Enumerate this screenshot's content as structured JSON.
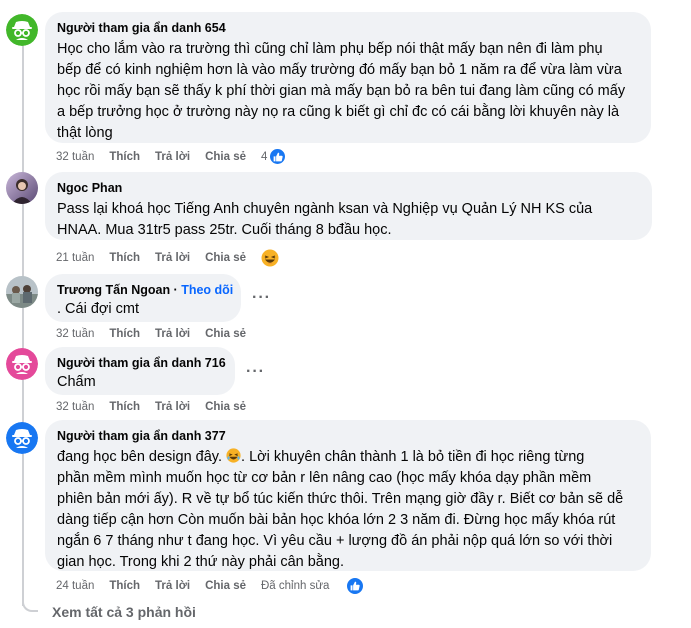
{
  "comments": [
    {
      "author": "Người tham gia ẩn danh 654",
      "lines": [
        "Học cho lắm vào ra trường thì cũng chỉ làm phụ bếp nói thật mấy bạn nên đi làm phụ",
        "bếp để có kinh nghiệm hơn là vào mấy trường đó mấy bạn bỏ 1 năm ra để vừa làm vừa",
        "học rồi mấy bạn sẽ thấy k phí thời gian mà mấy bạn bỏ ra bên tui đang làm cũng có mấy",
        "a bếp trưởng học ở trường này nọ ra cũng k biết gì chỉ đc có cái bằng lời khuyên này là",
        "thật lòng"
      ],
      "time": "32 tuần",
      "like": "Thích",
      "reply": "Trả lời",
      "share": "Chia sẻ",
      "reaction_count": "4",
      "reaction": "like-icon",
      "avatar": "anonymous-icon",
      "avatar_color": "#42b72a"
    },
    {
      "author": "Ngoc Phan",
      "lines": [
        "Pass lại khoá học Tiếng Anh chuyên ngành ksan và Nghiệp vụ Quản Lý NH KS của",
        "HNAA. Mua 31tr5 pass 25tr. Cuối tháng 8 bđầu học."
      ],
      "time": "21 tuần",
      "like": "Thích",
      "reply": "Trả lời",
      "share": "Chia sẻ",
      "reaction": "haha-icon",
      "avatar": "profile-photo"
    },
    {
      "author": "Trương Tấn Ngoan",
      "follow_sep": " · ",
      "follow": "Theo dõi",
      "lines": [
        ". Cái đợi cmt"
      ],
      "time": "32 tuần",
      "like": "Thích",
      "reply": "Trả lời",
      "share": "Chia sẻ",
      "avatar": "profile-photo"
    },
    {
      "author": "Người tham gia ẩn danh 716",
      "lines": [
        "Chấm"
      ],
      "time": "32 tuần",
      "like": "Thích",
      "reply": "Trả lời",
      "share": "Chia sẻ",
      "avatar": "anonymous-icon",
      "avatar_color": "#e4499a"
    },
    {
      "author": "Người tham gia ẩn danh 377",
      "first_line_a": "đang học bên design đây.",
      "first_line_b": ". Lời khuyên chân thành 1 là bỏ tiền đi học riêng từng",
      "lines": [
        "phần mềm mình muốn học từ cơ bản r lên nâng cao (học mấy khóa dạy phần mềm",
        "phiên bản mới ấy). R về tự bổ túc kiến thức thôi. Trên mạng giờ đầy r. Biết cơ bản sẽ dễ",
        "dàng tiếp cận hơn Còn muốn bài bản học khóa lớn 2 3 năm đi. Đừng học mấy khóa rút",
        "ngắn 6 7 tháng như t đang học. Vì yêu cầu + lượng đồ án phải nộp quá lớn so với thời",
        "gian học. Trong khi 2 thứ này phải cân bằng."
      ],
      "time": "24 tuần",
      "like": "Thích",
      "reply": "Trả lời",
      "share": "Chia sẻ",
      "edited": "Đã chỉnh sửa",
      "reaction": "like-icon",
      "avatar": "anonymous-icon",
      "avatar_color": "#1877f2"
    }
  ],
  "view_all": "Xem tất cả 3 phản hồi",
  "colors": {
    "bubble": "#f0f2f5",
    "meta": "#65676b",
    "link": "#0866ff",
    "like": "#1877f2"
  }
}
